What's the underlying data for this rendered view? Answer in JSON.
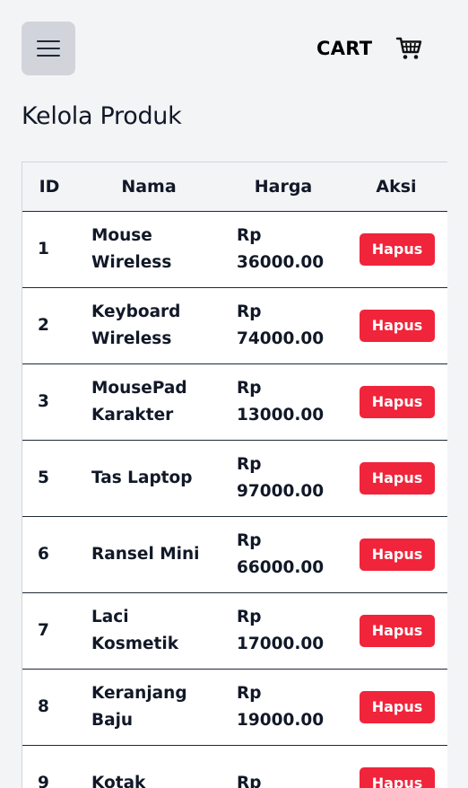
{
  "header": {
    "menu_icon": "hamburger-menu-icon",
    "cart_label": "CART",
    "cart_icon": "shopping-cart-icon"
  },
  "page": {
    "title": "Kelola Produk"
  },
  "table": {
    "columns": [
      "ID",
      "Nama",
      "Harga",
      "Aksi"
    ],
    "rows": [
      {
        "id": "1",
        "name": "Mouse Wireless",
        "price": "Rp 36000.00",
        "action": "Hapus"
      },
      {
        "id": "2",
        "name": "Keyboard Wireless",
        "price": "Rp 74000.00",
        "action": "Hapus"
      },
      {
        "id": "3",
        "name": "MousePad Karakter",
        "price": "Rp 13000.00",
        "action": "Hapus"
      },
      {
        "id": "5",
        "name": "Tas Laptop",
        "price": "Rp 97000.00",
        "action": "Hapus"
      },
      {
        "id": "6",
        "name": "Ransel Mini",
        "price": "Rp 66000.00",
        "action": "Hapus"
      },
      {
        "id": "7",
        "name": "Laci Kosmetik",
        "price": "Rp 17000.00",
        "action": "Hapus"
      },
      {
        "id": "8",
        "name": "Keranjang Baju",
        "price": "Rp 19000.00",
        "action": "Hapus"
      },
      {
        "id": "9",
        "name": "Kotak",
        "price": "Rp",
        "action": "Hapus"
      }
    ]
  },
  "colors": {
    "page_background": "#f3f4f6",
    "menu_button_background": "#d1d5db",
    "delete_button": "#f0243a",
    "text": "#111827"
  }
}
